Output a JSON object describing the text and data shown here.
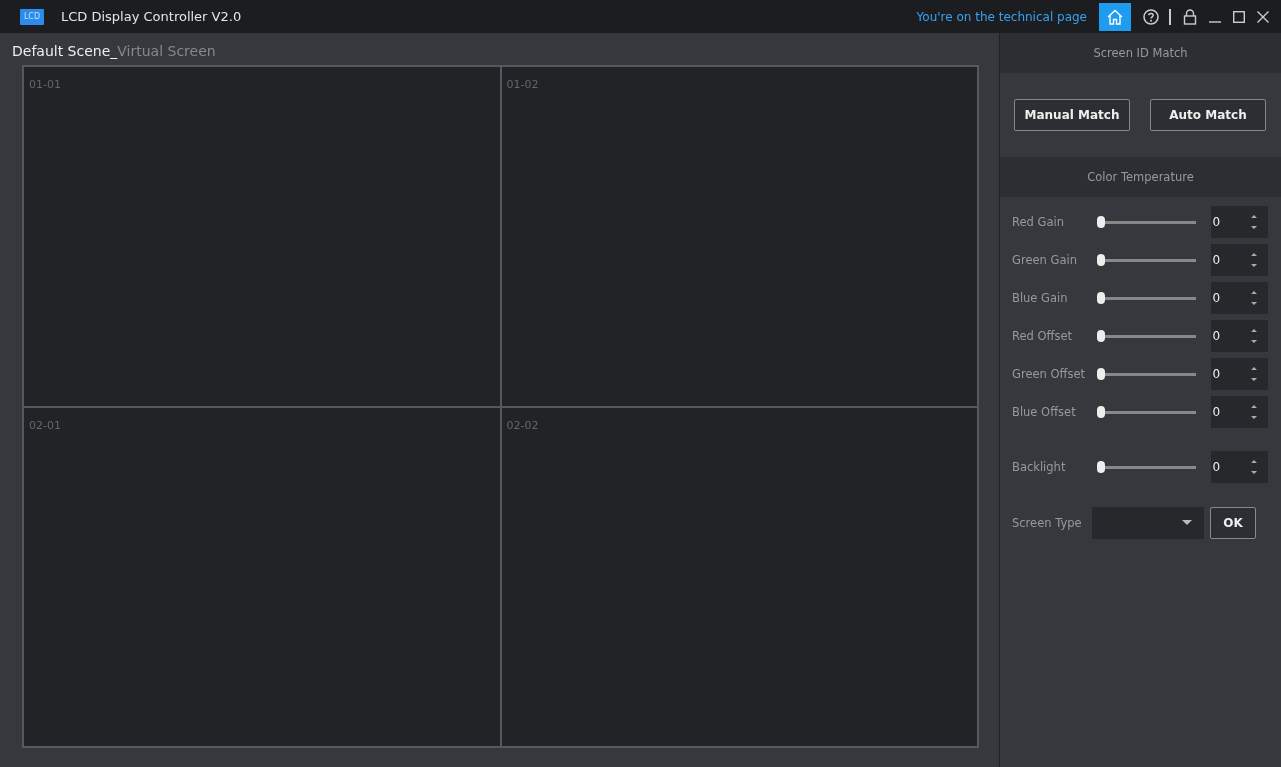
{
  "window": {
    "title": "LCD Display Controller V2.0",
    "logo_text": "LCD",
    "notice": "You're on the technical page"
  },
  "scene": {
    "name": "Default Scene_",
    "subtitle": "Virtual Screen"
  },
  "screens": [
    {
      "label": "01-01"
    },
    {
      "label": "01-02"
    },
    {
      "label": "02-01"
    },
    {
      "label": "02-02"
    }
  ],
  "screen_id_match": {
    "title": "Screen ID Match",
    "buttons": [
      "Manual Match",
      "Auto Match"
    ]
  },
  "color_temperature": {
    "title": "Color Temperature",
    "controls": [
      {
        "label": "Red Gain",
        "level": 0,
        "value": "0"
      },
      {
        "label": "Green Gain",
        "level": 0,
        "value": "0"
      },
      {
        "label": "Blue Gain",
        "level": 0,
        "value": "0"
      },
      {
        "label": "Red Offset",
        "level": 0,
        "value": "0"
      },
      {
        "label": "Green Offset",
        "level": 0,
        "value": "0"
      },
      {
        "label": "Blue Offset",
        "level": 0,
        "value": "0"
      }
    ],
    "backlight": {
      "label": "Backlight",
      "level": 0,
      "value": "0"
    },
    "screen_type": {
      "label": "Screen Type",
      "button": "OK"
    }
  }
}
